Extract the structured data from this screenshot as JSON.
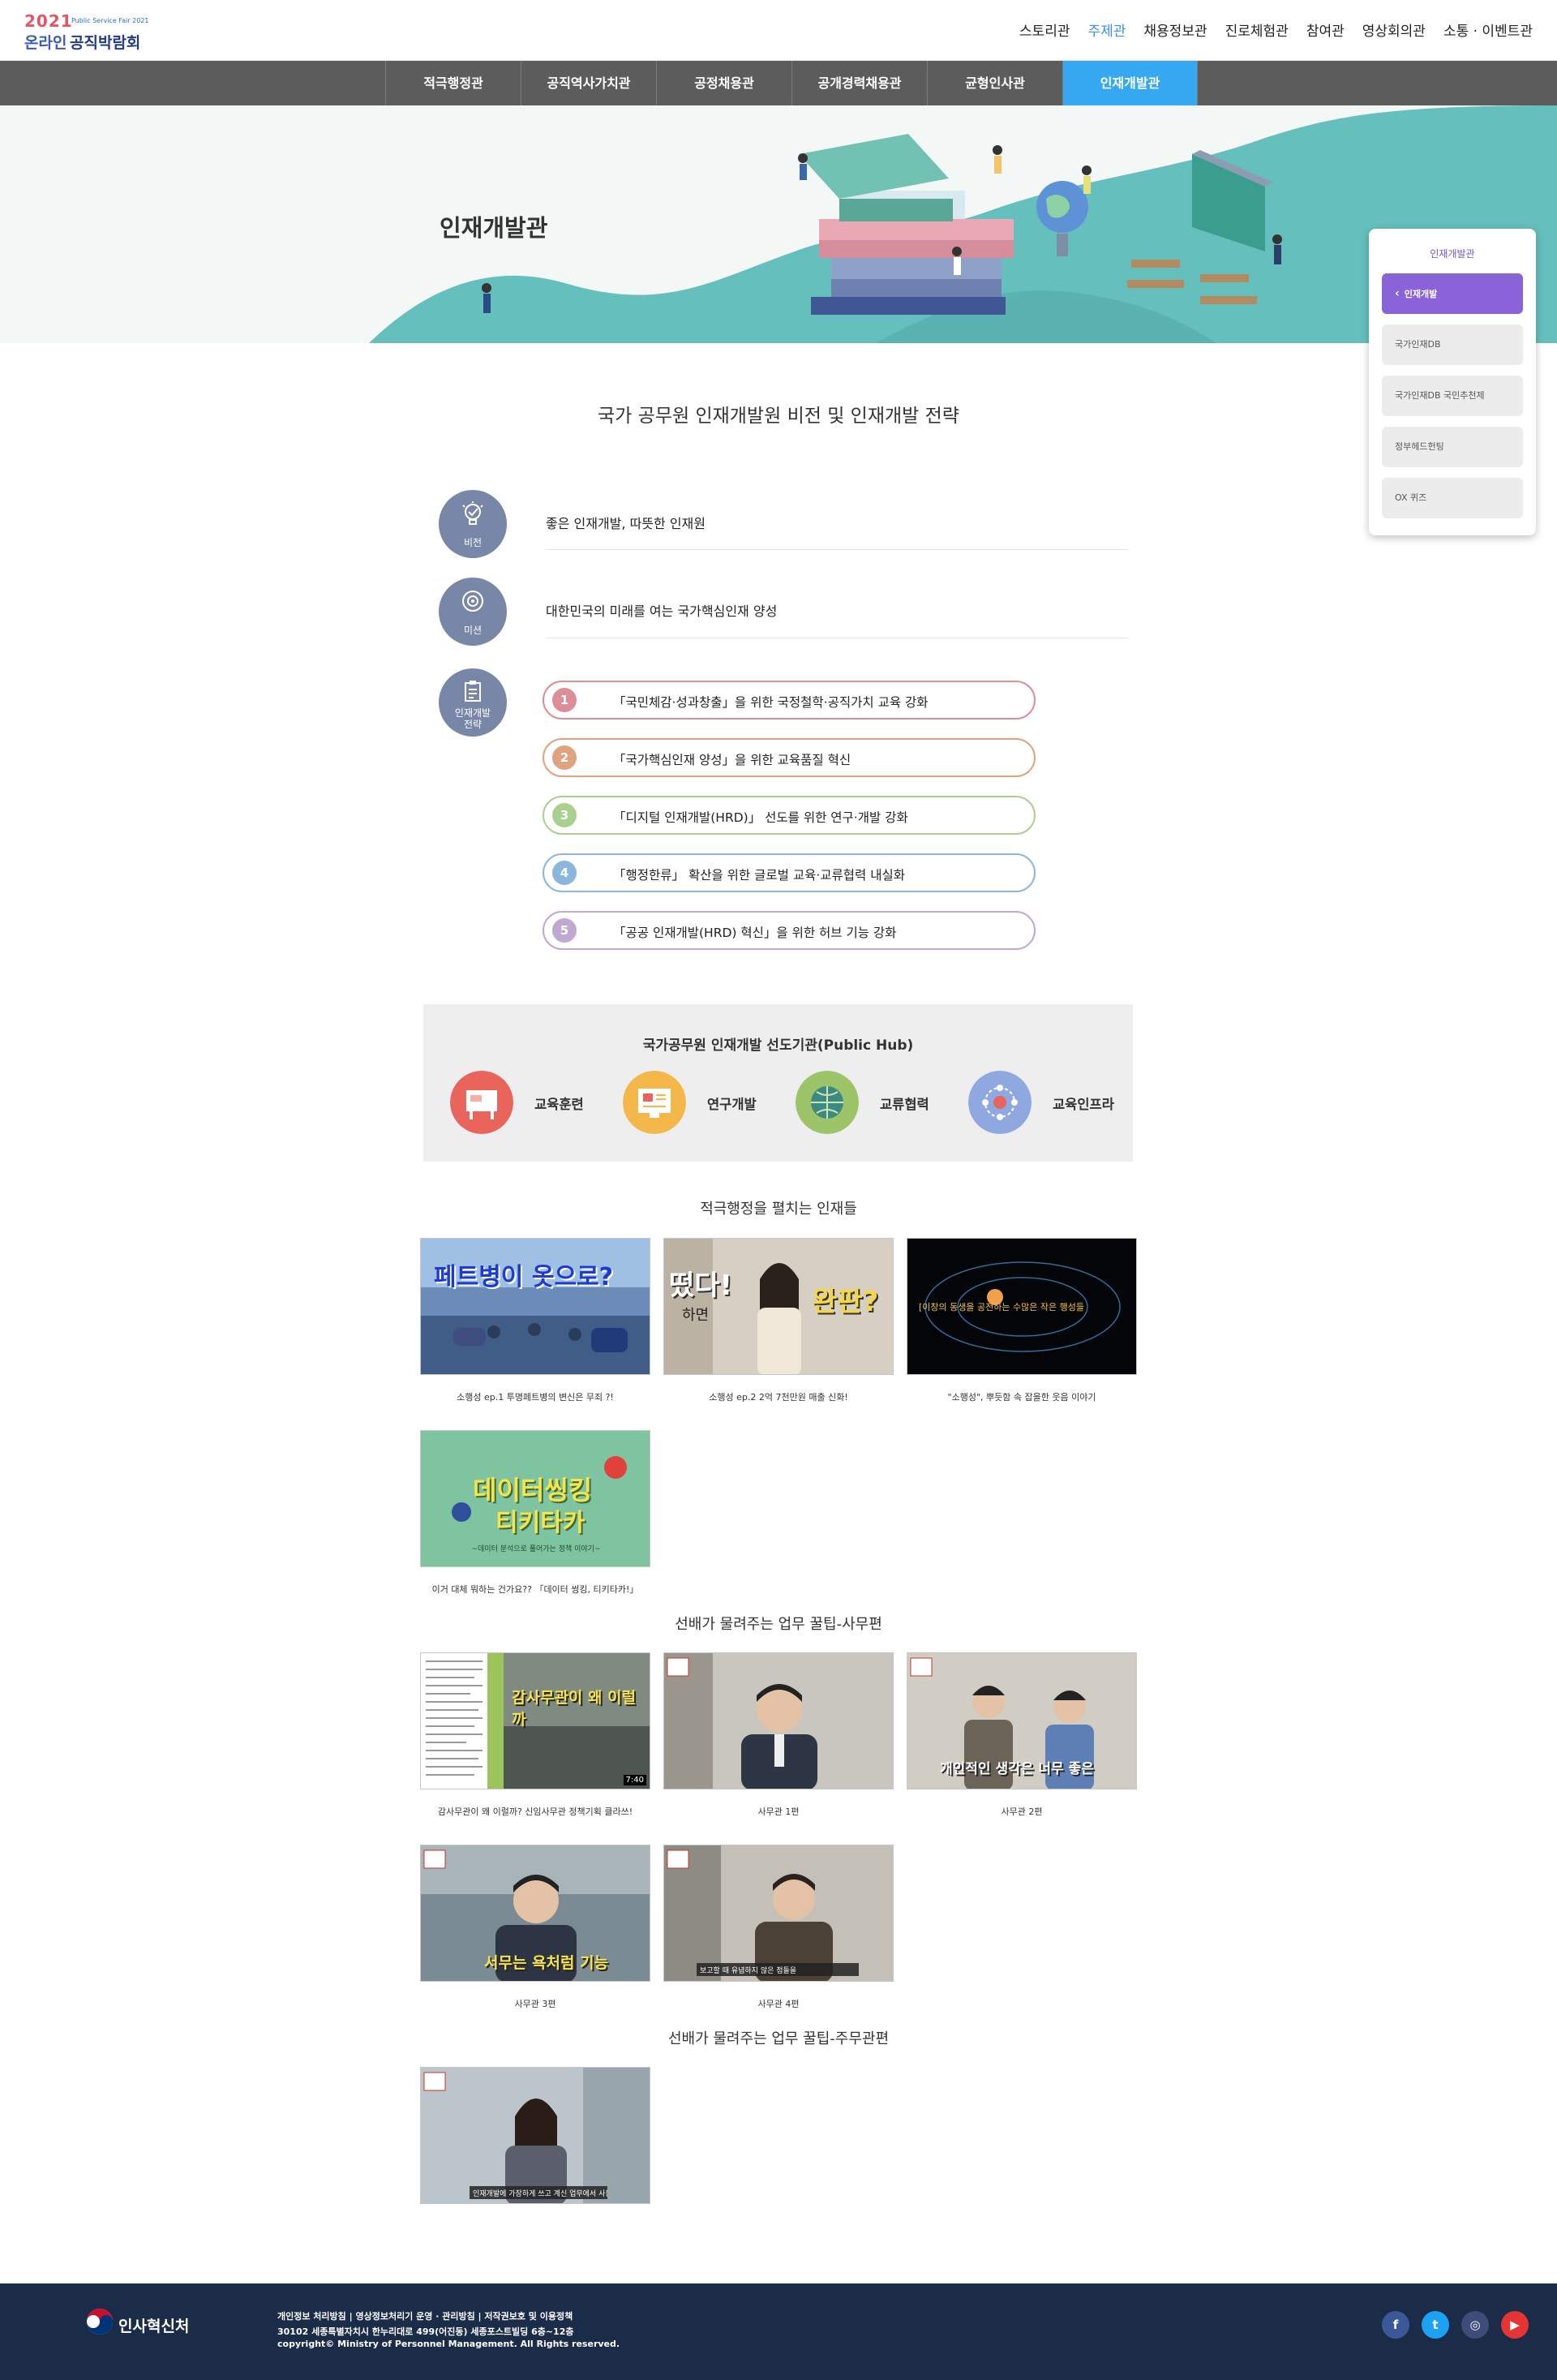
{
  "logo": {
    "year": "2021",
    "sub": "Public Service Fair 2021",
    "line1": "온라인",
    "line2": "공직박람회"
  },
  "topnav": [
    "스토리관",
    "주제관",
    "채용정보관",
    "진로체험관",
    "참여관",
    "영상회의관",
    "소통 · 이벤트관"
  ],
  "subnav": [
    "적극행정관",
    "공직역사가치관",
    "공정채용관",
    "공개경력채용관",
    "균형인사관",
    "인재개발관"
  ],
  "hero": {
    "title": "인재개발관"
  },
  "side": {
    "title": "인재개발관",
    "items": [
      "인재개발",
      "국가인재DB",
      "국가인재DB 국민추천제",
      "정부헤드헌팅",
      "OX 퀴즈"
    ]
  },
  "vision": {
    "title": "국가 공무원 인재개발원 비전 및 인재개발 전략",
    "vision_label": "비전",
    "vision_text": "좋은 인재개발, 따뜻한 인재원",
    "mission_label": "미션",
    "mission_text": "대한민국의 미래를 여는 국가핵심인재 양성",
    "strategy_label_1": "인재개발",
    "strategy_label_2": "전략",
    "strategies": [
      {
        "num": "1",
        "text": "「국민체감·성과창출」을 위한 국정철학·공직가치 교육 강화",
        "color": "#dd8d97"
      },
      {
        "num": "2",
        "text": "「국가핵심인재 양성」을 위한 교육품질 혁신",
        "color": "#dfa37f"
      },
      {
        "num": "3",
        "text": "「디지털 인재개발(HRD)」 선도를 위한 연구·개발 강화",
        "color": "#a9d08e"
      },
      {
        "num": "4",
        "text": "「행정한류」 확산을 위한 글로벌 교육·교류협력 내실화",
        "color": "#8bb7dc"
      },
      {
        "num": "5",
        "text": "「공공 인재개발(HRD) 혁신」을 위한 허브 기능 강화",
        "color": "#bfa8d1"
      }
    ]
  },
  "hub": {
    "title": "국가공무원 인재개발 선도기관(Public Hub)",
    "items": [
      {
        "name": "교육훈련",
        "color": "#e9645a",
        "icon": "board-icon"
      },
      {
        "name": "연구개발",
        "color": "#f4b74a",
        "icon": "report-icon"
      },
      {
        "name": "교류협력",
        "color": "#9ec46a",
        "icon": "globe-icon"
      },
      {
        "name": "교육인프라",
        "color": "#8fa9e0",
        "icon": "network-icon"
      }
    ]
  },
  "videos": {
    "section1": {
      "title": "적극행정을 펼치는 인재들",
      "items": [
        {
          "caption": "소행성 ep.1 투명페트병의 변신은 무죄 ?!",
          "overlay": "페트병이 옷으로?"
        },
        {
          "caption": "소행성 ep.2 2억 7천만원 매출 신화!",
          "overlay_left": "떴다!",
          "overlay_small": "하면",
          "overlay_right": "완판?"
        },
        {
          "caption": "\"소행성\", 뿌듯함 속 잡을한 웃음 이야기",
          "overlay": "[이창의 동생을 공전하는 수많은 작은 행성들"
        },
        {
          "caption": "이거 대체 뭐하는 건가요?? 「데이터 썽킹, 티키타카!」",
          "overlay_1": "데이터씽킹",
          "overlay_2": "티키타카",
          "overlay_3": "~데이터 분석으로 풀어가는 정책 이야기~"
        }
      ]
    },
    "section2": {
      "title": "선배가 물려주는 업무 꿀팁-사무편",
      "items": [
        {
          "caption": "감사무관이 왜 이럴까? 신임사무관 정책기획 클라쓰!",
          "overlay": "감사무관이 왜 이럴까",
          "duration": "7:40"
        },
        {
          "caption": "사무관 1편"
        },
        {
          "caption": "사무관 2편",
          "overlay": "개인적인 생각은 너무 좋은"
        },
        {
          "caption": "사무관 3편",
          "overlay": "서무는 욕처럼 기능"
        },
        {
          "caption": "사무관 4편",
          "overlay": "보고할 때 유념하지 않은 점들을"
        }
      ]
    },
    "section3": {
      "title": "선배가 물려주는 업무 꿀팁-주무관편",
      "items": [
        {
          "caption": "",
          "overlay": "인재개발에 가장하게 쓰고 계신 업무에서 사용 후"
        }
      ]
    }
  },
  "footer": {
    "org": "인사혁신처",
    "links": "개인정보 처리방침  |  영상정보처리기 운영 · 관리방침  |  저작권보호 및 이용정책",
    "address": "30102 세종특별자치시 한누리대로 499(어진동) 세종포스트빌딩 6층~12층",
    "copyright": "copyright© Ministry of Personnel Management. All Rights reserved.",
    "sns": [
      {
        "name": "facebook-icon",
        "glyph": "f",
        "color": "#3b5998"
      },
      {
        "name": "twitter-icon",
        "glyph": "t",
        "color": "#1da1f2"
      },
      {
        "name": "instagram-icon",
        "glyph": "◎",
        "color": "#3f4c7a"
      },
      {
        "name": "youtube-icon",
        "glyph": "▶",
        "color": "#e53434"
      }
    ]
  }
}
